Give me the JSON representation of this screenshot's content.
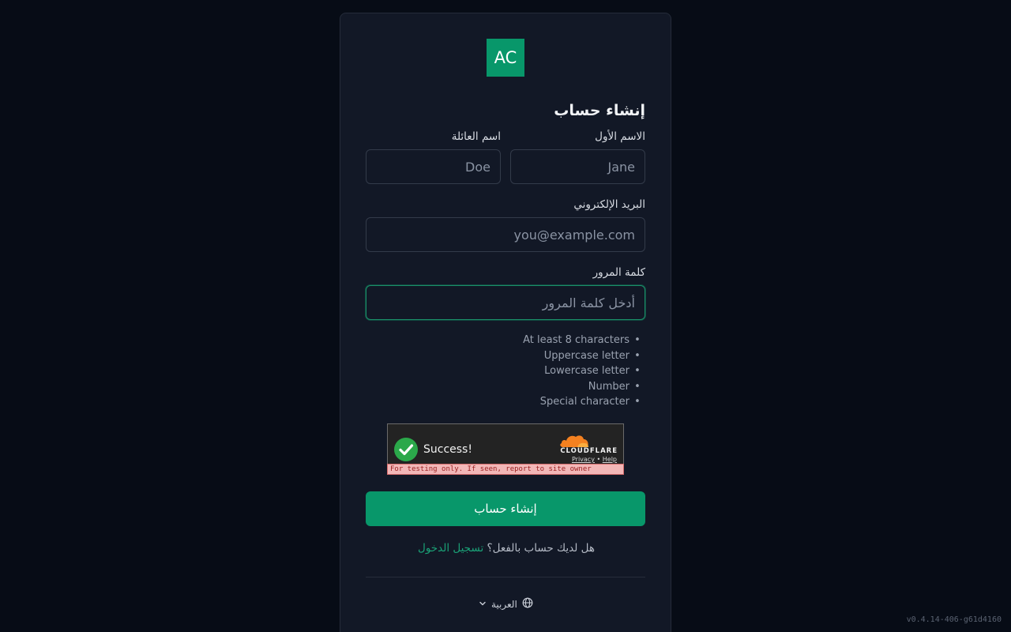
{
  "logo": {
    "text": "AC"
  },
  "form": {
    "title": "إنشاء حساب",
    "first_name": {
      "label": "الاسم الأول",
      "placeholder": "Jane"
    },
    "last_name": {
      "label": "اسم العائلة",
      "placeholder": "Doe"
    },
    "email": {
      "label": "البريد الإلكتروني",
      "placeholder": "you@example.com"
    },
    "password": {
      "label": "كلمة المرور",
      "placeholder": "أدخل كلمة المرور"
    },
    "requirements": [
      "At least 8 characters",
      "Uppercase letter",
      "Lowercase letter",
      "Number",
      "Special character"
    ],
    "submit_label": "إنشاء حساب",
    "signin_prompt": "هل لديك حساب بالفعل؟",
    "signin_link": "تسجيل الدخول"
  },
  "captcha": {
    "status": "Success!",
    "brand": "CLOUDFLARE",
    "privacy": "Privacy",
    "separator": "•",
    "help": "Help",
    "warning": "For testing only. If seen, report to site owner"
  },
  "language": {
    "current": "العربية",
    "icon": "globe-icon"
  },
  "footer": {
    "version": "v0.4.14-406-g61d4160"
  },
  "colors": {
    "accent": "#08976a",
    "background": "#070c16",
    "card": "#121826"
  }
}
